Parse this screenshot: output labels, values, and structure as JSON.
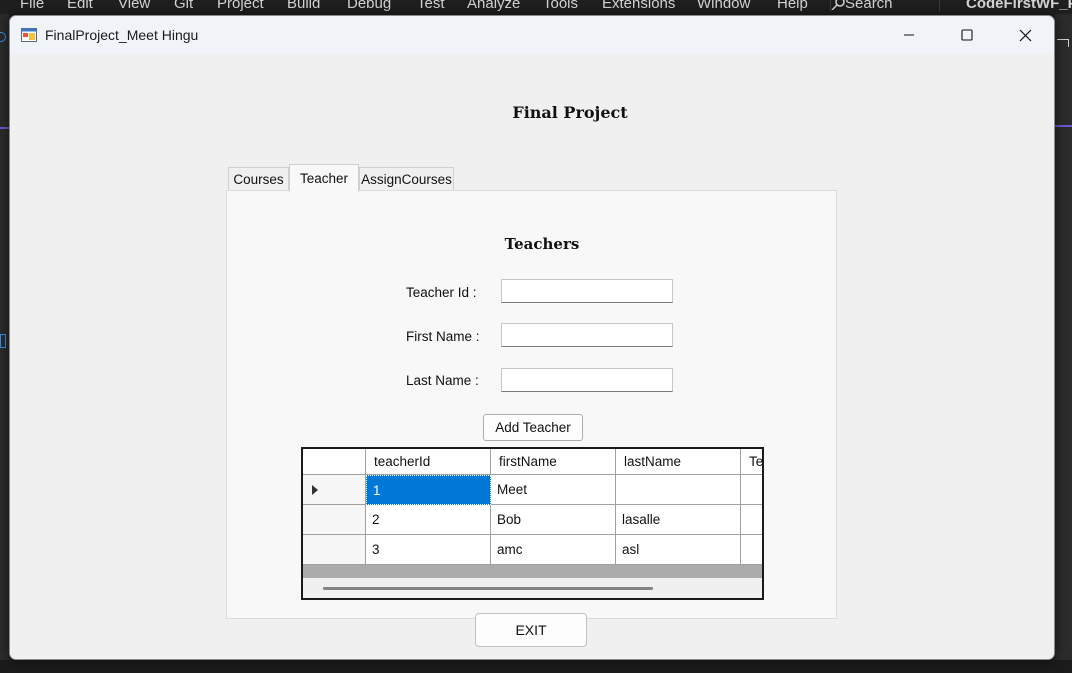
{
  "ide": {
    "menu": [
      "File",
      "Edit",
      "View",
      "Git",
      "Project",
      "Build",
      "Debug",
      "Test",
      "Analyze",
      "Tools",
      "Extensions",
      "Window",
      "Help"
    ],
    "search_label": "Search",
    "solution_name": "CodeFirstWF_Pr",
    "accent_color": "#6e56cf"
  },
  "window": {
    "title": "FinalProject_Meet Hingu",
    "controls": [
      "minimize-icon",
      "maximize-icon",
      "close-icon"
    ]
  },
  "form": {
    "title": "Final Project",
    "tabs": [
      {
        "label": "Courses",
        "selected": false
      },
      {
        "label": "Teacher",
        "selected": true
      },
      {
        "label": "AssignCourses",
        "selected": false
      }
    ],
    "heading": "Teachers",
    "fields": [
      {
        "label": "Teacher Id :",
        "value": ""
      },
      {
        "label": "First Name :",
        "value": ""
      },
      {
        "label": "Last Name :",
        "value": ""
      }
    ],
    "add_button_label": "Add Teacher",
    "exit_button_label": "EXIT"
  },
  "grid": {
    "columns": [
      "teacherId",
      "firstName",
      "lastName",
      "Te"
    ],
    "rows": [
      [
        "1",
        "Meet",
        "",
        ""
      ],
      [
        "2",
        "Bob",
        "lasalle",
        ""
      ],
      [
        "3",
        "amc",
        "asl",
        ""
      ]
    ],
    "current_row_indicator": "row-pointer-icon",
    "selected_color": "#0078d7"
  }
}
